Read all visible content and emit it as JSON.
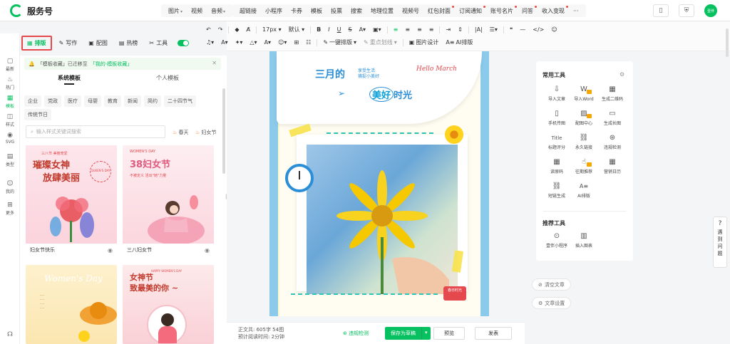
{
  "app": {
    "title": "服务号"
  },
  "top_menu": {
    "group1": [
      {
        "label": "图片",
        "caret": true
      },
      {
        "label": "视频",
        "caret": false
      },
      {
        "label": "音频",
        "caret": true
      }
    ],
    "group2": [
      {
        "label": "超链接",
        "dot": false
      },
      {
        "label": "小程序",
        "dot": false
      },
      {
        "label": "卡券",
        "dot": false
      },
      {
        "label": "模板",
        "dot": false
      },
      {
        "label": "投票",
        "dot": false
      },
      {
        "label": "搜索",
        "dot": false
      },
      {
        "label": "地理位置",
        "dot": false
      },
      {
        "label": "视频号",
        "dot": false
      },
      {
        "label": "红包封面",
        "dot": true
      },
      {
        "label": "订阅通知",
        "dot": true
      },
      {
        "label": "账号名片",
        "dot": true
      },
      {
        "label": "问答",
        "dot": true
      },
      {
        "label": "收入变现",
        "dot": true
      },
      {
        "label": "···",
        "dot": false
      }
    ],
    "avatar_text": "壹伴"
  },
  "rail": [
    {
      "label": "最新",
      "icon": "💬",
      "active": false
    },
    {
      "label": "热门",
      "icon": "🔥",
      "active": false
    },
    {
      "label": "模板",
      "icon": "▦",
      "active": true
    },
    {
      "label": "样式",
      "icon": "◫",
      "active": false
    },
    {
      "label": "SVG",
      "icon": "◉",
      "active": false
    },
    {
      "label": "类型",
      "icon": "▤",
      "active": false
    },
    {
      "label": "我的",
      "icon": "☺",
      "active": false
    },
    {
      "label": "更多",
      "icon": "⊞",
      "active": false
    }
  ],
  "plugin_tabs": [
    {
      "label": "排版",
      "icon": "▦",
      "active": true
    },
    {
      "label": "写作",
      "icon": "✎",
      "active": false
    },
    {
      "label": "配图",
      "icon": "▣",
      "active": false
    },
    {
      "label": "热榜",
      "icon": "▤",
      "active": false
    },
    {
      "label": "工具",
      "icon": "✂",
      "active": false
    }
  ],
  "notice": {
    "prefix": "「模板收藏」已迁移至",
    "link": "「我的-模板收藏」"
  },
  "template_tabs": {
    "system": "系统模板",
    "personal": "个人模板"
  },
  "categories_row1": [
    "企业",
    "党政",
    "医疗",
    "母婴",
    "教育",
    "新闻",
    "简约",
    "二十四节气"
  ],
  "categories_row2": [
    "传统节日"
  ],
  "search": {
    "placeholder": "输入样式关键词搜索",
    "hot1": "春天",
    "hot2": "妇女节"
  },
  "cards": [
    {
      "name": "妇女节快乐",
      "lines": [
        "璀璨女神",
        "放肆美丽"
      ],
      "small": "三八节 美丽宠爱",
      "badge": "QUEEN'S DAY"
    },
    {
      "name": "三八妇女节",
      "lines": [
        "38妇女节"
      ],
      "small": "WOMEN'S DAY",
      "caption": "不被定义 活出\"她\"力量"
    },
    {
      "name": "",
      "lines": [
        "Women's Day"
      ],
      "small": "",
      "caption": ""
    },
    {
      "name": "",
      "lines": [
        "女神节",
        "致最美的你 ~"
      ],
      "small": "HAPPY WOMEN'S DAY",
      "caption": ""
    }
  ],
  "toolbar": {
    "row1": [
      "↶",
      "↷",
      "|",
      "◆",
      "A",
      "|",
      "17px",
      "默认",
      "|",
      "B",
      "I",
      "U",
      "S",
      "A",
      "ab",
      "|",
      "≡",
      "≡",
      "≡",
      "≡",
      "|",
      "≡",
      "≡",
      "|",
      "|A|",
      "≡",
      "|",
      "❝",
      "—",
      "</>",
      "☺"
    ],
    "row2_left": [
      "♫",
      "A",
      "✦",
      "△",
      "A",
      "☺",
      "⊞",
      "☷"
    ],
    "row2_labels": [
      "一键排版",
      "重点划线",
      "图片设计",
      "AI排版"
    ]
  },
  "article": {
    "title": "三月的",
    "subtitle_lines": [
      "享受生活",
      "捕捉小美好"
    ],
    "hello": "Hello March",
    "beauty": "美好",
    "beauty_suffix": "时光",
    "bus_label": "春日时光"
  },
  "status": {
    "words_label": "正文共:",
    "words_value": "605字 54图",
    "read_label": "预计阅读时间:",
    "read_value": "2分钟",
    "check": "违规检测",
    "save": "保存为草稿",
    "preview": "预览",
    "publish": "发表"
  },
  "tools": {
    "common_title": "常用工具",
    "common": [
      {
        "label": "导入文章",
        "icon": "⇩",
        "badge": false
      },
      {
        "label": "导入Word",
        "icon": "W",
        "badge": true
      },
      {
        "label": "生成二维码",
        "icon": "▦",
        "badge": false
      },
      {
        "label": "手机传图",
        "icon": "▯",
        "badge": false
      },
      {
        "label": "配图中心",
        "icon": "▨",
        "badge": true
      },
      {
        "label": "生成长图",
        "icon": "▭",
        "badge": false
      },
      {
        "label": "标题评分",
        "icon": "T",
        "badge": false
      },
      {
        "label": "永久链接",
        "icon": "⛓",
        "badge": false
      },
      {
        "label": "违规检测",
        "icon": "⊛",
        "badge": false
      },
      {
        "label": "读原码",
        "icon": "▦",
        "badge": false
      },
      {
        "label": "往期推荐",
        "icon": "👍",
        "badge": true
      },
      {
        "label": "营销日历",
        "icon": "▦",
        "badge": false
      },
      {
        "label": "短链生成",
        "icon": "⛓",
        "badge": false
      },
      {
        "label": "AI排版",
        "icon": "A≡",
        "badge": false
      }
    ],
    "recommend_title": "推荐工具",
    "recommend": [
      {
        "label": "壹伴小程序",
        "icon": "⊙"
      },
      {
        "label": "插入图表",
        "icon": "▥"
      }
    ]
  },
  "side_pills": {
    "clear": "清空文章",
    "settings": "文章设置"
  },
  "feedback": [
    "遇",
    "到",
    "问",
    "题"
  ]
}
